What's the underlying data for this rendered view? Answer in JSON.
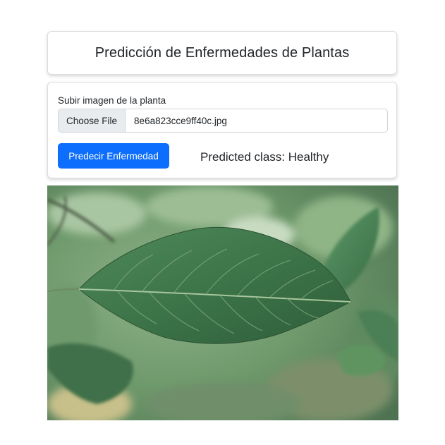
{
  "header": {
    "title": "Predicción de Enfermedades de Plantas"
  },
  "upload": {
    "label": "Subir imagen de la planta",
    "choose_button_label": "Choose File",
    "file_name": "8e6a823cce9ff40c.jpg"
  },
  "actions": {
    "predict_label": "Predecir Enfermedad"
  },
  "result": {
    "text": "Predicted class: Healthy"
  },
  "colors": {
    "primary": "#0d6efd",
    "leaf": "#3f7a4a",
    "background_foliage": "#7fa37a"
  }
}
